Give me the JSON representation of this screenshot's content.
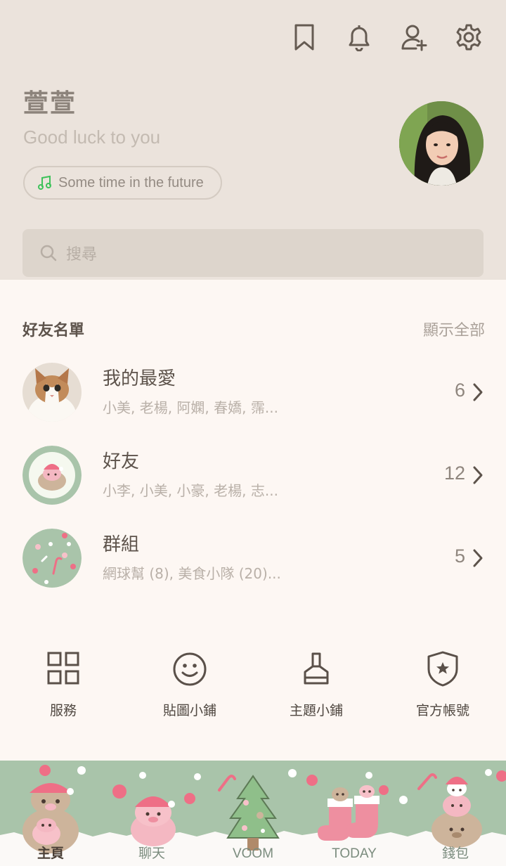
{
  "header": {
    "profile_name": "萱萱",
    "status_message": "Good luck to you",
    "music": "Some time in the future",
    "search_placeholder": "搜尋",
    "icons": [
      "bookmark-icon",
      "bell-icon",
      "add-friend-icon",
      "gear-icon"
    ]
  },
  "friends": {
    "title": "好友名單",
    "show_all": "顯示全部",
    "rows": [
      {
        "title": "我的最愛",
        "subtitle": "小美, 老楊, 阿嫻, 春嬌, 霈...",
        "count": "6"
      },
      {
        "title": "好友",
        "subtitle": "小李, 小美, 小豪, 老楊, 志...",
        "count": "12"
      },
      {
        "title": "群組",
        "subtitle": "網球幫 (8), 美食小隊 (20)...",
        "count": "5"
      }
    ]
  },
  "shortcuts": [
    {
      "label": "服務",
      "icon": "grid-icon"
    },
    {
      "label": "貼圖小鋪",
      "icon": "smiley-icon"
    },
    {
      "label": "主題小鋪",
      "icon": "brush-icon"
    },
    {
      "label": "官方帳號",
      "icon": "shield-star-icon"
    }
  ],
  "nav": [
    {
      "label": "主頁"
    },
    {
      "label": "聊天"
    },
    {
      "label": "VOOM"
    },
    {
      "label": "TODAY"
    },
    {
      "label": "錢包"
    }
  ],
  "colors": {
    "header_bg": "#ebe3dc",
    "page_bg": "#fdf7f3",
    "nav_bg": "#a9c4aa",
    "music_note": "#3ec25a"
  }
}
